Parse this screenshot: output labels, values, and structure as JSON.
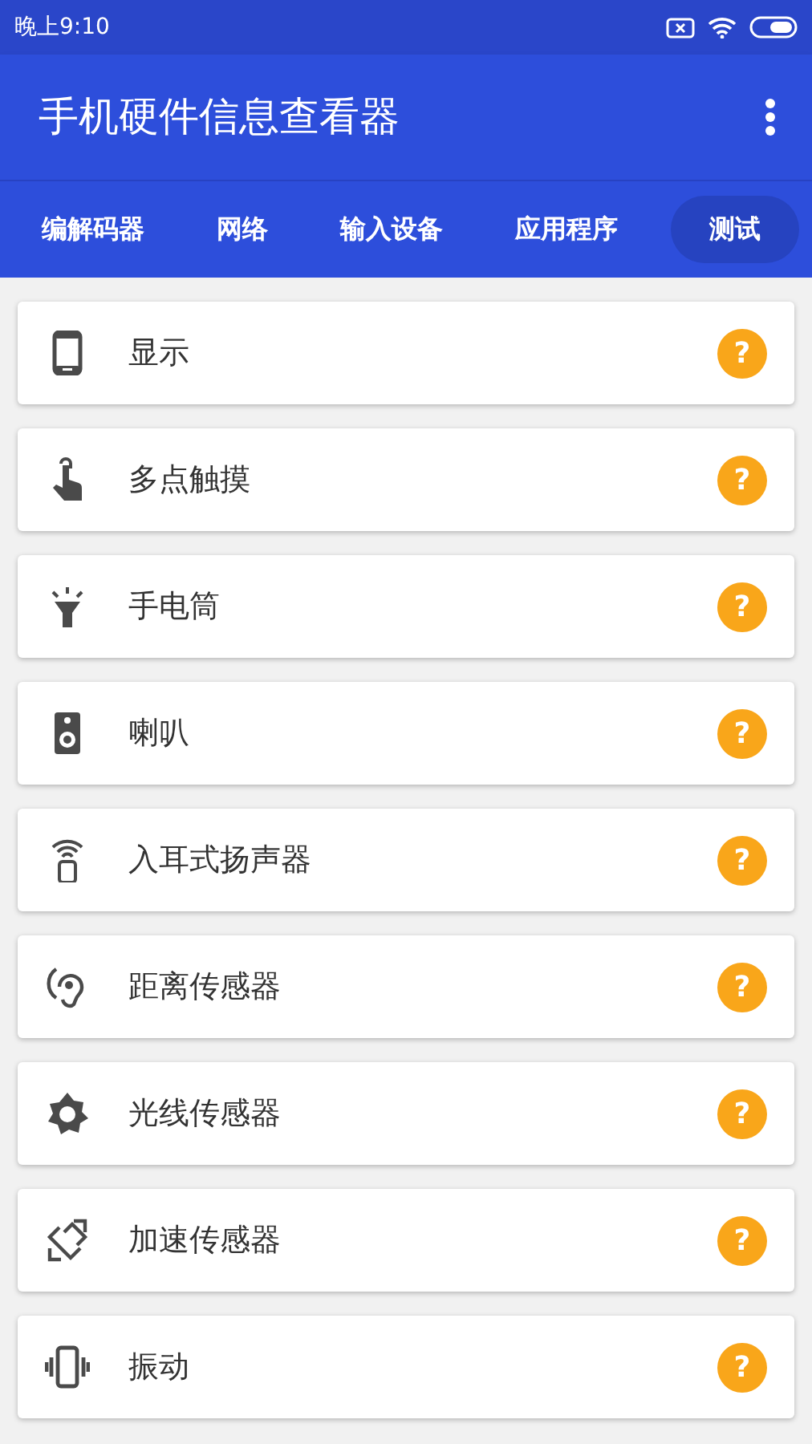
{
  "status_bar": {
    "time": "晚上9:10"
  },
  "app_bar": {
    "title": "手机硬件信息查看器"
  },
  "tabs": [
    {
      "label": "编解码器",
      "selected": false
    },
    {
      "label": "网络",
      "selected": false
    },
    {
      "label": "输入设备",
      "selected": false
    },
    {
      "label": "应用程序",
      "selected": false
    },
    {
      "label": "测试",
      "selected": true
    }
  ],
  "tests": [
    {
      "label": "显示",
      "badge": "?"
    },
    {
      "label": "多点触摸",
      "badge": "?"
    },
    {
      "label": "手电筒",
      "badge": "?"
    },
    {
      "label": "喇叭",
      "badge": "?"
    },
    {
      "label": "入耳式扬声器",
      "badge": "?"
    },
    {
      "label": "距离传感器",
      "badge": "?"
    },
    {
      "label": "光线传感器",
      "badge": "?"
    },
    {
      "label": "加速传感器",
      "badge": "?"
    },
    {
      "label": "振动",
      "badge": "?"
    }
  ]
}
